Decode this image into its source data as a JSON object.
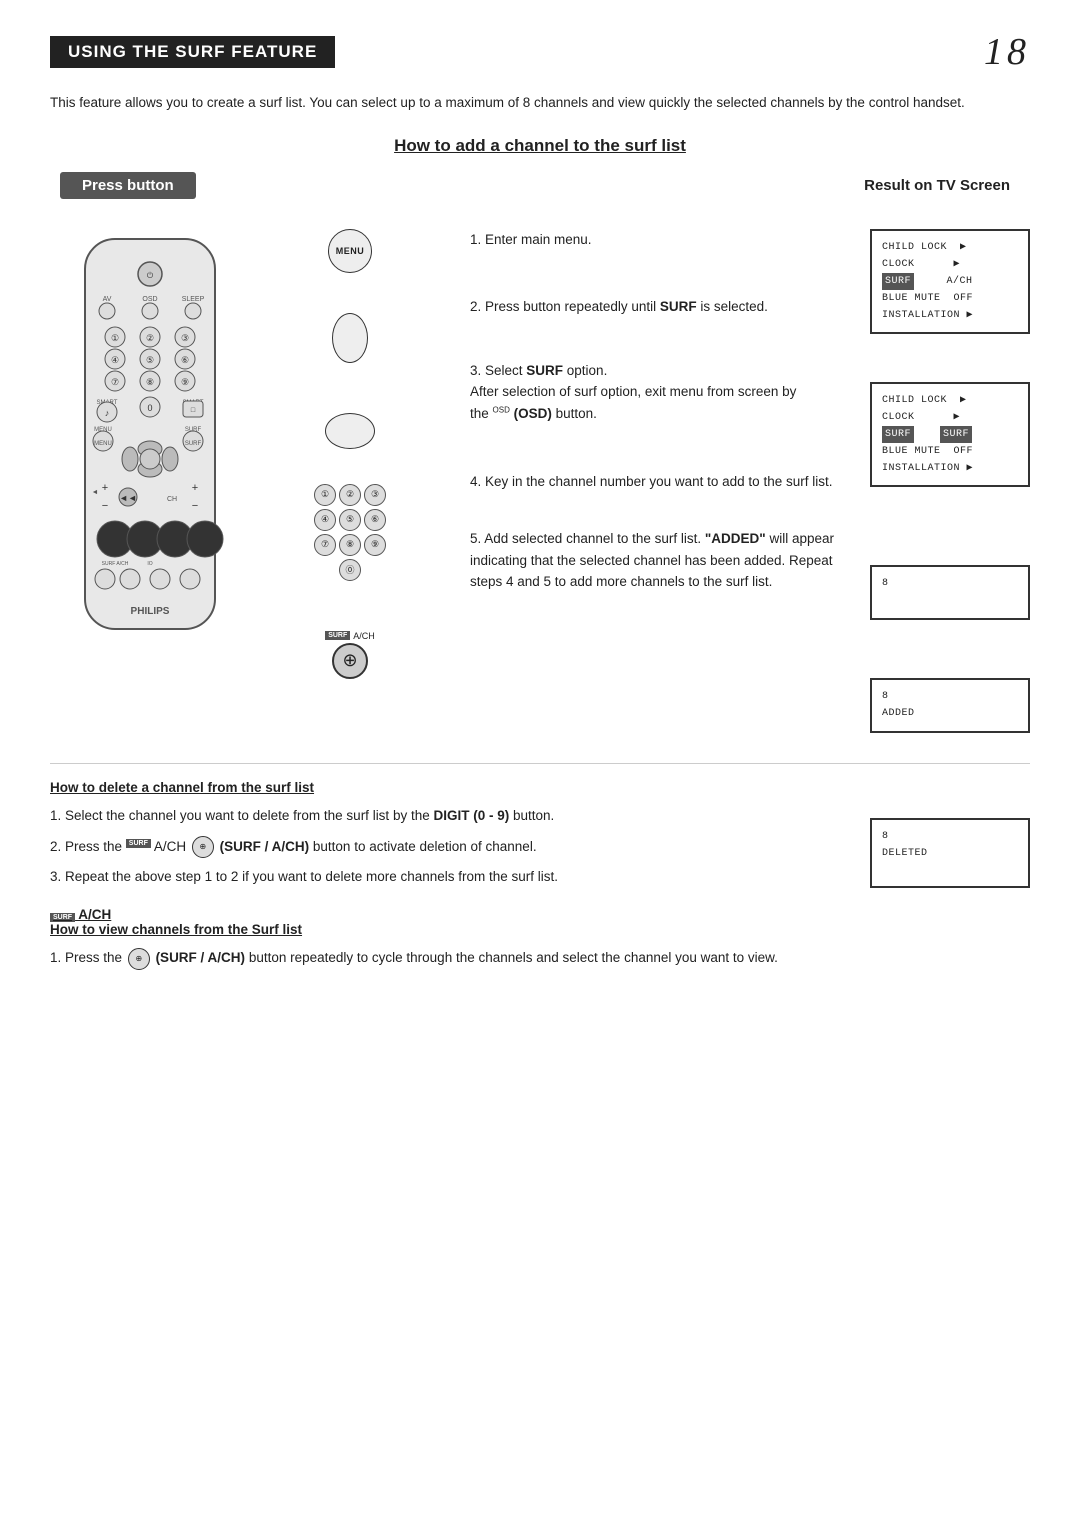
{
  "page": {
    "title": "Using the Surf Feature",
    "page_number": "18",
    "intro": "This feature allows you to create a surf list. You can select up to a maximum of 8 channels and view quickly the selected channels by the control handset.",
    "how_to_add_title": "How to add a channel to the surf list",
    "col_header_press": "Press button",
    "col_header_result": "Result on TV Screen",
    "steps": [
      {
        "id": 1,
        "text": "Enter main menu.",
        "button": "MENU"
      },
      {
        "id": 2,
        "text": "Press button repeatedly until SURF is selected.",
        "button": "oval"
      },
      {
        "id": 3,
        "text": "Select SURF option. After selection of surf option, exit menu from screen by the OSD button.",
        "button": "oval-wide"
      },
      {
        "id": 4,
        "text": "Key in the channel number you want to add to the surf list.",
        "button": "numpad"
      },
      {
        "id": 5,
        "text": "Add selected channel to the surf list. \"ADDED\" will appear indicating that the selected channel has been added. Repeat steps 4 and 5 to add more channels to the surf list.",
        "button": "surf"
      }
    ],
    "tv_screens": [
      {
        "id": 1,
        "lines": [
          "CHILD LOCK  ▶",
          "CLOCK       ▶",
          "SURF      A/CH",
          "BLUE MUTE OFF",
          "INSTALLATION ▶"
        ],
        "highlight_line": 2
      },
      {
        "id": 2,
        "lines": [
          "CHILD LOCK  ▶",
          "CLOCK       ▶",
          "SURF      SURF",
          "BLUE MUTE OFF",
          "INSTALLATION ▶"
        ],
        "highlight_line": 2
      },
      {
        "id": 3,
        "lines": [
          "8"
        ],
        "highlight_line": -1
      },
      {
        "id": 4,
        "lines": [
          "8",
          "ADDED"
        ],
        "highlight_line": -1
      }
    ],
    "how_to_delete_title": "How to delete a channel from the surf list",
    "delete_steps": [
      "Select the channel you want to delete from the surf list by the DIGIT (0 - 9) button.",
      "Press the (SURF / A/CH) button to activate deletion of channel.",
      "Repeat the above step 1 to 2 if you want to delete more channels from the surf list."
    ],
    "delete_screen": {
      "lines": [
        "8",
        "DELETED"
      ]
    },
    "how_to_view_title": "How to view channels from the Surf list",
    "view_steps": [
      "Press the (SURF / A/CH) button repeatedly to cycle through the channels and select the channel you want to view."
    ]
  }
}
